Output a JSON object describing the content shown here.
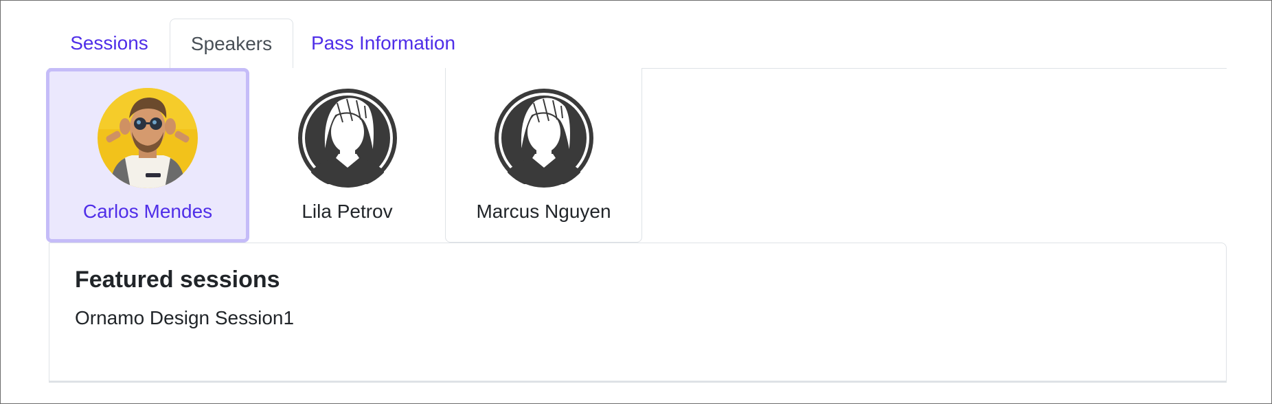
{
  "tabs": [
    {
      "label": "Sessions",
      "active": false
    },
    {
      "label": "Speakers",
      "active": true
    },
    {
      "label": "Pass Information",
      "active": false
    }
  ],
  "speakers": [
    {
      "name": "Carlos Mendes",
      "selected": true,
      "avatar_icon": "person-photo-avatar"
    },
    {
      "name": "Lila Petrov",
      "selected": false,
      "avatar_icon": "placeholder-avatar-icon"
    },
    {
      "name": "Marcus Nguyen",
      "selected": false,
      "avatar_icon": "placeholder-avatar-icon"
    }
  ],
  "featured": {
    "heading": "Featured sessions",
    "sessions": [
      "Ornamo Design Session1"
    ]
  },
  "colors": {
    "accent": "#4f2ee8",
    "selected_bg": "#ebe8fd",
    "selected_border": "#c5bcf8",
    "border": "#dee2e6"
  }
}
